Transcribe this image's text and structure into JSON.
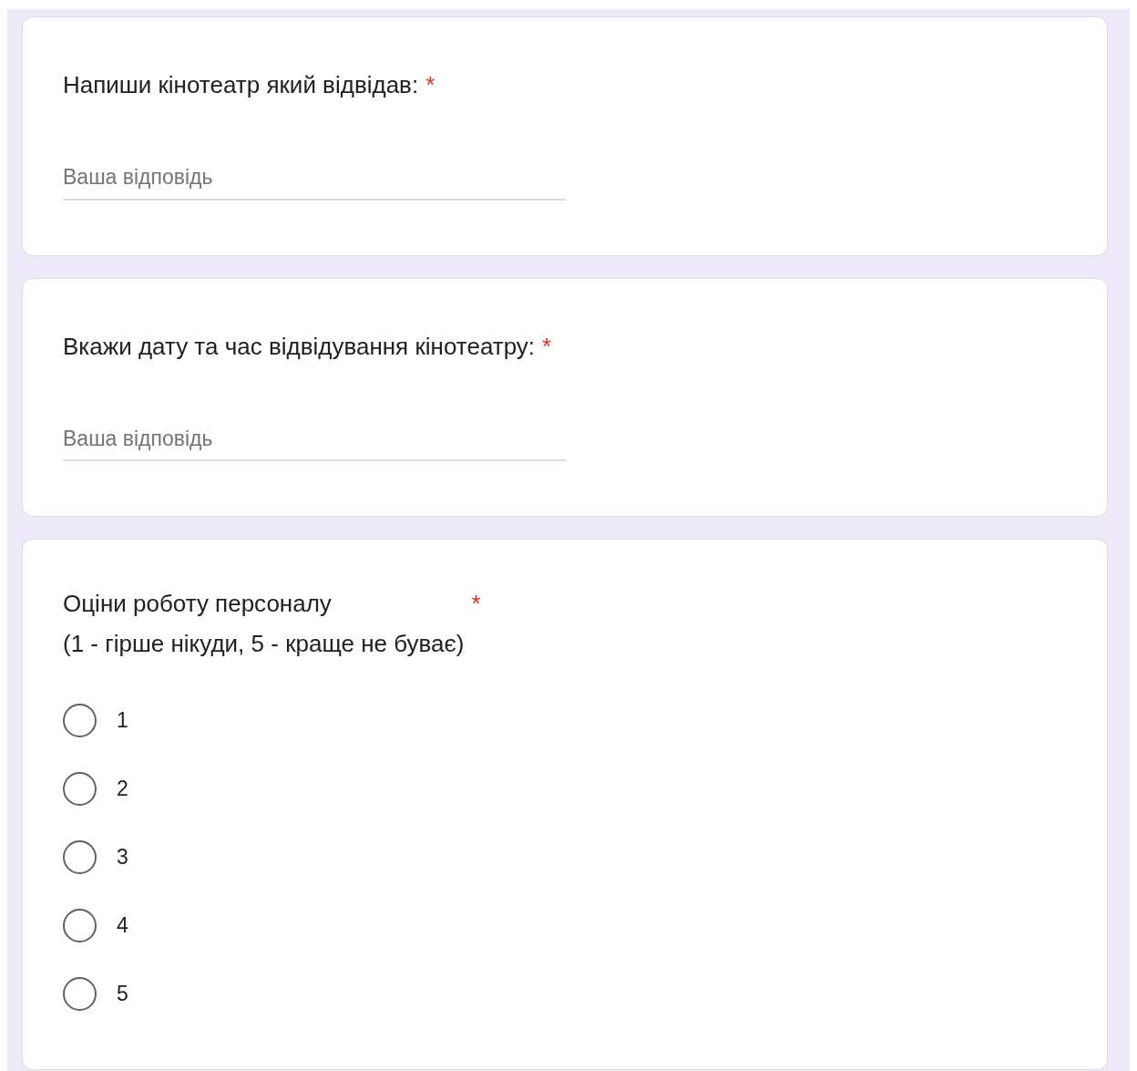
{
  "questions": [
    {
      "kind": "text",
      "title_lines": [
        "Напиши кінотеатр який відвідав:"
      ],
      "required_mark": "*",
      "placeholder": "Ваша відповідь"
    },
    {
      "kind": "text",
      "title_lines": [
        "Вкажи дату та час відвідування кінотеатру:"
      ],
      "required_mark": "*",
      "placeholder": "Ваша відповідь"
    },
    {
      "kind": "radio",
      "title_lines": [
        "Оціни роботу персоналу",
        "(1 - гірше нікуди, 5 - краще не буває)"
      ],
      "required_mark": "*",
      "options": [
        {
          "label": "1",
          "selected": false
        },
        {
          "label": "2",
          "selected": false
        },
        {
          "label": "3",
          "selected": false
        },
        {
          "label": "4",
          "selected": false
        },
        {
          "label": "5",
          "selected": false
        }
      ]
    }
  ]
}
